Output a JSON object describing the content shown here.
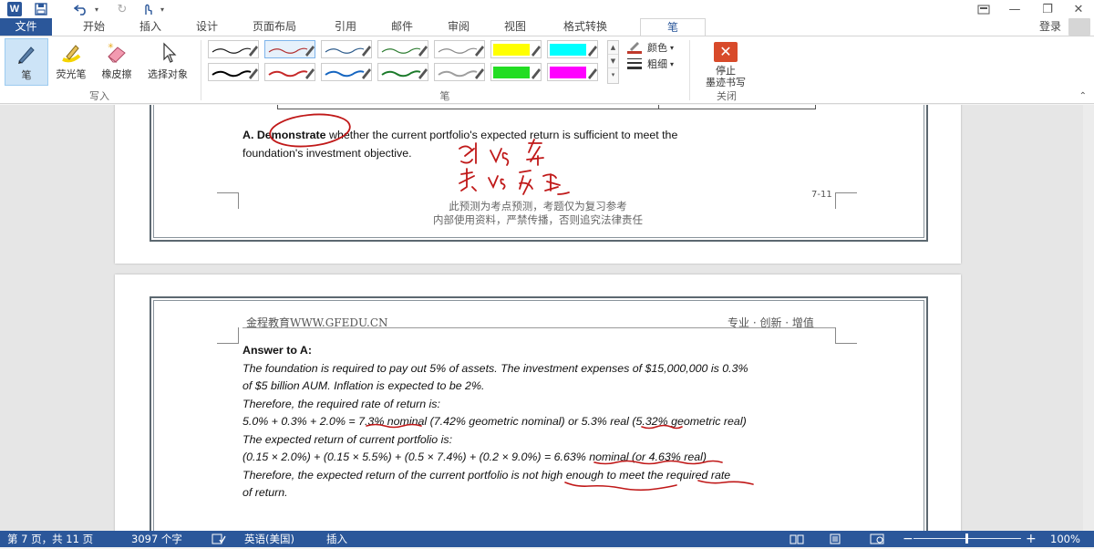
{
  "quick_access": {
    "word": "W"
  },
  "tabs": [
    {
      "label": "文件"
    },
    {
      "label": "开始"
    },
    {
      "label": "插入"
    },
    {
      "label": "设计"
    },
    {
      "label": "页面布局"
    },
    {
      "label": "引用"
    },
    {
      "label": "邮件"
    },
    {
      "label": "审阅"
    },
    {
      "label": "视图"
    },
    {
      "label": "格式转换"
    },
    {
      "label": "笔"
    }
  ],
  "login": "登录",
  "ribbon": {
    "write_group": {
      "label": "写入",
      "tools": [
        {
          "label": "笔",
          "icon": "pen-icon"
        },
        {
          "label": "荧光笔",
          "icon": "highlighter-icon"
        },
        {
          "label": "橡皮擦",
          "icon": "eraser-icon"
        },
        {
          "label": "选择对象",
          "icon": "select-pointer-icon"
        }
      ]
    },
    "pen_group": {
      "label": "笔",
      "swatches": [
        {
          "color": "#1a1a1a"
        },
        {
          "color": "#b23030"
        },
        {
          "color": "#2d5c8c"
        },
        {
          "color": "#2e7d32"
        },
        {
          "color": "#888888"
        },
        {
          "color": "#ffff00",
          "fill": true
        },
        {
          "color": "#00ffff",
          "fill": true
        },
        {
          "color": "#000000"
        },
        {
          "color": "#c62828"
        },
        {
          "color": "#1565c0"
        },
        {
          "color": "#1b7a2a"
        },
        {
          "color": "#9e9e9e"
        },
        {
          "color": "#22dd22",
          "fill": true
        },
        {
          "color": "#ff00ff",
          "fill": true
        }
      ],
      "color_label": "颜色",
      "thickness_label": "粗细"
    },
    "close_group": {
      "label": "关闭",
      "stop_line1": "停止",
      "stop_line2": "墨迹书写"
    }
  },
  "page1": {
    "question_prefix": "A. Demonstrate",
    "question_rest": " whether the current portfolio's expected return is sufficient to meet the",
    "question_line2": "foundation's investment objective.",
    "page_number": "7-11",
    "notice_line1": "此预测为考点预测，考题仅为复习参考",
    "notice_line2": "内部使用资料，严禁传播，否则追究法律责任"
  },
  "page2": {
    "header_left": "金程教育WWW.GFEDU.CN",
    "header_right": "专业 · 创新 · 增值",
    "answer_heading": "Answer to A:",
    "lines": [
      "The foundation is required to pay out 5% of assets. The investment expenses of $15,000,000 is 0.3%",
      "of $5 billion AUM. Inflation is expected to be 2%.",
      "Therefore, the required rate of return is:",
      "5.0% + 0.3% + 2.0% = 7.3% nominal (7.42% geometric nominal) or 5.3% real (5.32% geometric real)",
      "The expected return of current portfolio is:",
      "(0.15 × 2.0%) + (0.15 × 5.5%) + (0.5 × 7.4%) + (0.2 × 9.0%) = 6.63% nominal (or 4.63% real)",
      "Therefore, the expected return of the current portfolio is not high enough to meet the required rate",
      "of return."
    ]
  },
  "status": {
    "page_info": "第 7 页，共 11 页",
    "word_count": "3097 个字",
    "language": "英语(美国)",
    "mode": "插入",
    "zoom": "100%"
  }
}
